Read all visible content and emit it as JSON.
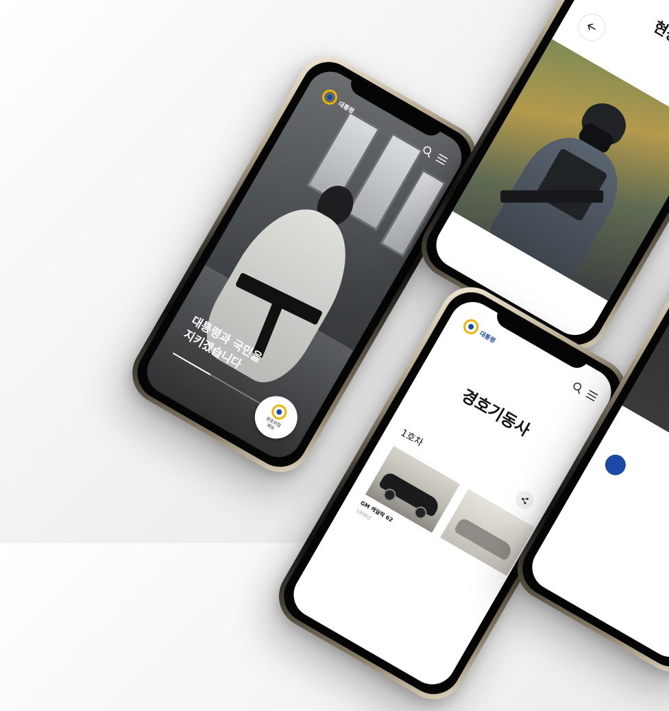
{
  "phone_hero": {
    "logo_text": "대통령",
    "headline_line1": "대통령과 국민을",
    "headline_line2": "지키겠습니다",
    "progress": 0.35,
    "badge_line1": "경호위험",
    "badge_line2": "제보"
  },
  "phone_field": {
    "title": "현장",
    "back_icon": "arrow-left-icon"
  },
  "phone_vehicle": {
    "logo_text": "대통령",
    "title": "경호기동사",
    "section_label": "1호차",
    "car_name": "GM 캐딜락 62",
    "car_year": "1956년"
  },
  "colors": {
    "logo_ring": "#f0b400",
    "logo_core": "#1d49a6"
  }
}
